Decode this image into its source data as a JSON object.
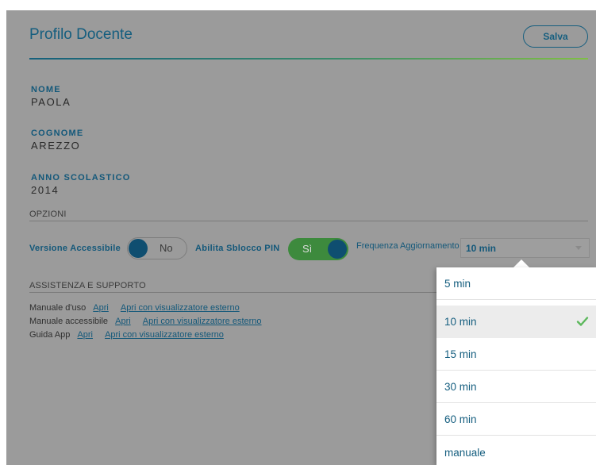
{
  "header": {
    "title": "Profilo Docente",
    "save_label": "Salva"
  },
  "profile": {
    "fields": [
      {
        "label": "NOME",
        "value": "PAOLA"
      },
      {
        "label": "COGNOME",
        "value": "AREZZO"
      },
      {
        "label": "ANNO SCOLASTICO",
        "value": "2014"
      }
    ]
  },
  "options": {
    "section_title": "OPZIONI",
    "accessible": {
      "label": "Versione Accessibile",
      "state": "No"
    },
    "pin": {
      "label": "Abilita Sblocco PIN",
      "state": "Sì"
    },
    "frequency": {
      "label": "Frequenza Aggiornamento",
      "selected": "10 min",
      "options": [
        "5 min",
        "10 min",
        "15 min",
        "30 min",
        "60 min",
        "manuale"
      ]
    }
  },
  "support": {
    "section_title": "ASSISTENZA E SUPPORTO",
    "rows": [
      {
        "label": "Manuale d'uso",
        "open": "Apri",
        "open_external": "Apri con visualizzatore esterno"
      },
      {
        "label": "Manuale accessibile",
        "open": "Apri",
        "open_external": "Apri con visualizzatore esterno"
      },
      {
        "label": "Guida App",
        "open": "Apri",
        "open_external": "Apri con visualizzatore esterno"
      }
    ]
  },
  "colors": {
    "accent": "#155e7f",
    "toggle_on": "#3d8a3d",
    "check": "#5cb85c"
  },
  "icons": {
    "selected_marker": "check-icon",
    "select_caret": "chevron-down-icon"
  }
}
